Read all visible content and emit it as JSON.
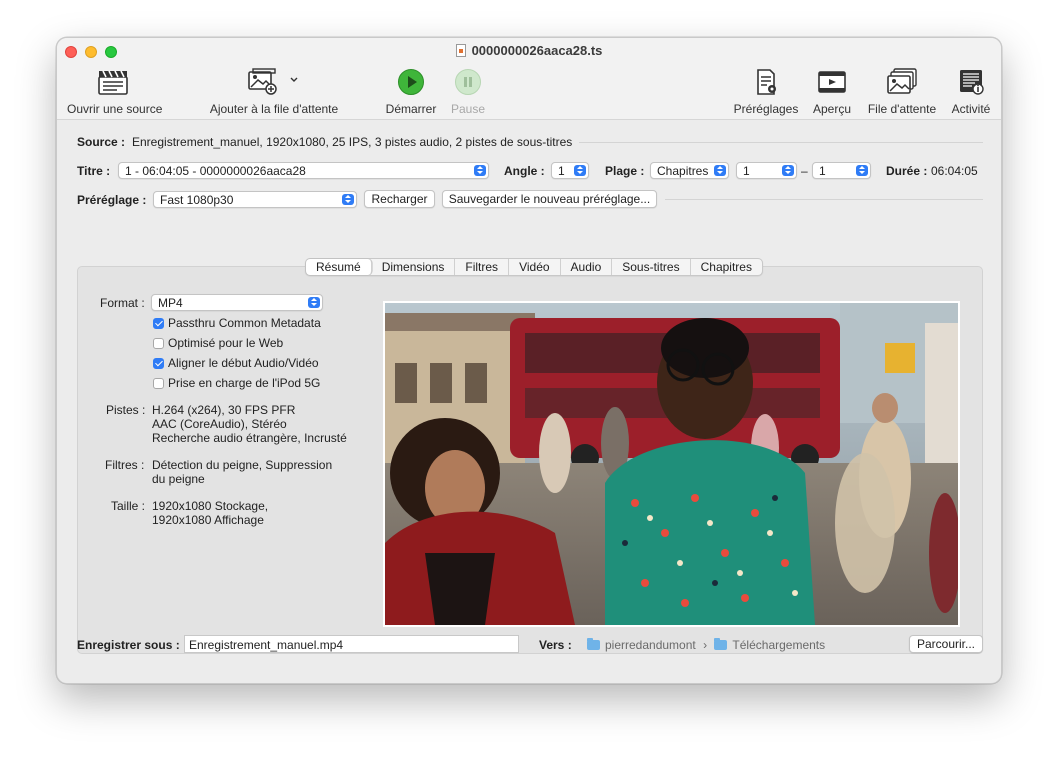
{
  "window": {
    "title": "0000000026aaca28.ts"
  },
  "toolbar": {
    "open_source": "Ouvrir une source",
    "add_to_queue": "Ajouter à la file d'attente",
    "start": "Démarrer",
    "pause": "Pause",
    "presets": "Préréglages",
    "preview": "Aperçu",
    "queue": "File d'attente",
    "activity": "Activité"
  },
  "source": {
    "label": "Source :",
    "value": "Enregistrement_manuel, 1920x1080, 25 IPS, 3 pistes audio, 2 pistes de sous-titres"
  },
  "title_row": {
    "title_label": "Titre :",
    "title_value": "1 - 06:04:05 - 0000000026aaca28",
    "angle_label": "Angle :",
    "angle_value": "1",
    "range_label": "Plage :",
    "range_type": "Chapitres",
    "range_start": "1",
    "range_sep": "–",
    "range_end": "1",
    "duration_label": "Durée :",
    "duration_value": "06:04:05"
  },
  "preset_row": {
    "label": "Préréglage :",
    "value": "Fast 1080p30",
    "reload": "Recharger",
    "save_new": "Sauvegarder le nouveau préréglage..."
  },
  "tabs": [
    "Résumé",
    "Dimensions",
    "Filtres",
    "Vidéo",
    "Audio",
    "Sous-titres",
    "Chapitres"
  ],
  "summary": {
    "format_label": "Format :",
    "format_value": "MP4",
    "checkboxes": [
      {
        "label": "Passthru Common Metadata",
        "checked": true
      },
      {
        "label": "Optimisé pour le Web",
        "checked": false
      },
      {
        "label": "Aligner le début Audio/Vidéo",
        "checked": true
      },
      {
        "label": "Prise en charge de l'iPod 5G",
        "checked": false
      }
    ],
    "tracks_label": "Pistes :",
    "tracks": [
      "H.264 (x264), 30 FPS PFR",
      "AAC (CoreAudio), Stéréo",
      "Recherche audio étrangère, Incrusté"
    ],
    "filters_label": "Filtres :",
    "filters": [
      "Détection du peigne, Suppression",
      "du peigne"
    ],
    "size_label": "Taille :",
    "size": [
      "1920x1080 Stockage,",
      "1920x1080 Affichage"
    ]
  },
  "save": {
    "label": "Enregistrer sous :",
    "filename": "Enregistrement_manuel.mp4",
    "to_label": "Vers :",
    "path_user": "pierredandumont",
    "path_arrow": "›",
    "path_folder": "Téléchargements",
    "browse": "Parcourir..."
  },
  "colors": {
    "accent": "#2f7cf6",
    "start_green": "#3fb53a",
    "close": "#fe5f57",
    "minimize": "#febc2e",
    "maximize": "#28c840"
  }
}
